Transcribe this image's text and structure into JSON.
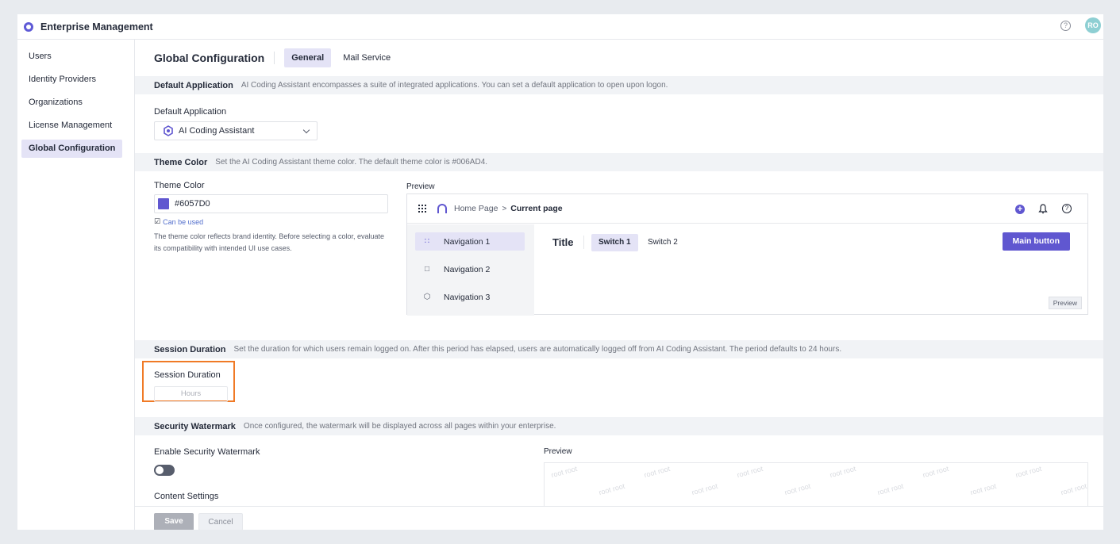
{
  "app": {
    "title": "Enterprise Management",
    "avatar_initials": "RO",
    "help_glyph": "?"
  },
  "sidebar": {
    "items": [
      {
        "label": "Users"
      },
      {
        "label": "Identity Providers"
      },
      {
        "label": "Organizations"
      },
      {
        "label": "License Management"
      },
      {
        "label": "Global Configuration",
        "active": true
      }
    ]
  },
  "page": {
    "title": "Global Configuration",
    "tabs": [
      {
        "label": "General",
        "active": true
      },
      {
        "label": "Mail Service"
      }
    ]
  },
  "default_application": {
    "section_title": "Default Application",
    "section_desc": "AI Coding Assistant encompasses a suite of integrated applications. You can set a default application to open upon logon.",
    "field_label": "Default Application",
    "selected": "AI Coding Assistant"
  },
  "theme_color": {
    "section_title": "Theme Color",
    "section_desc": "Set the AI Coding Assistant theme color. The default theme color is #006AD4.",
    "field_label": "Theme Color",
    "value": "#6057D0",
    "can_be_used": "Can be used",
    "note": "The theme color reflects brand identity. Before selecting a color, evaluate its compatibility with intended UI use cases.",
    "preview_label": "Preview",
    "preview": {
      "breadcrumb_home": "Home Page",
      "breadcrumb_sep": ">",
      "breadcrumb_current": "Current page",
      "nav": [
        "Navigation 1",
        "Navigation 2",
        "Navigation 3"
      ],
      "title": "Title",
      "switch_1": "Switch 1",
      "switch_2": "Switch 2",
      "main_button": "Main button",
      "badge": "Preview",
      "plus_glyph": "+",
      "help_glyph": "?"
    },
    "accent_color": "#6057D0"
  },
  "session_duration": {
    "section_title": "Session Duration",
    "section_desc": "Set the duration for which users remain logged on. After this period has elapsed, users are automatically logged off from AI Coding Assistant. The period defaults to 24 hours.",
    "field_label": "Session Duration",
    "placeholder": "Hours"
  },
  "security_watermark": {
    "section_title": "Security Watermark",
    "section_desc": "Once configured, the watermark will be displayed across all pages within your enterprise.",
    "enable_label": "Enable Security Watermark",
    "enabled": false,
    "content_settings_label": "Content Settings",
    "preview_label": "Preview",
    "watermark_text": "root root"
  },
  "footer": {
    "save": "Save",
    "cancel": "Cancel"
  }
}
